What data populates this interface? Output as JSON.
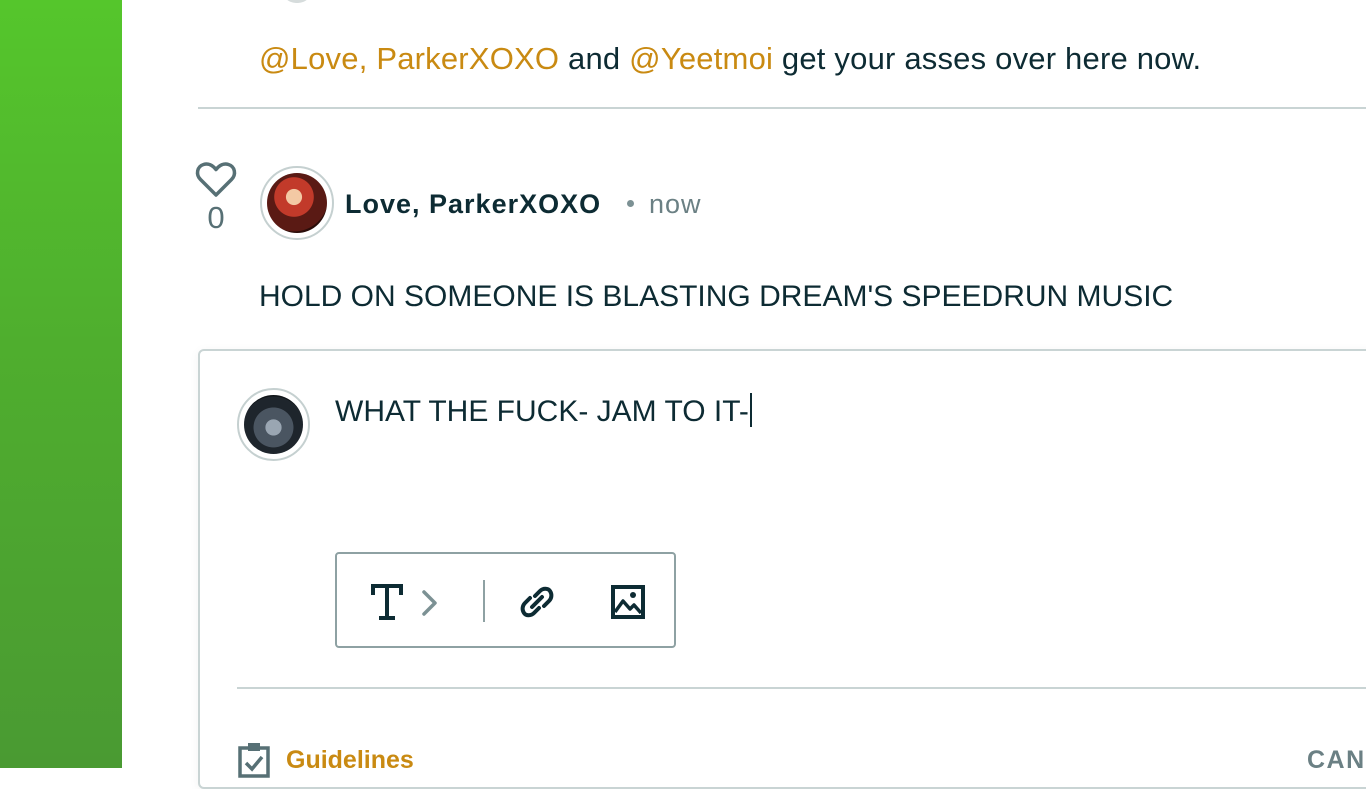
{
  "previous_comment": {
    "mention_1": "@Love, ParkerXOXO",
    "text_1": " and ",
    "mention_2": "@Yeetmoi",
    "text_2": " get your asses over here now."
  },
  "comment": {
    "like_count": "0",
    "author": "Love, ParkerXOXO",
    "timestamp": "now",
    "body": "HOLD ON SOMEONE IS BLASTING DREAM'S SPEEDRUN MUSIC"
  },
  "reply": {
    "value": "WHAT THE FUCK- JAM TO IT-"
  },
  "toolbar": {
    "icons": [
      "text-format-icon",
      "chevron-right-icon",
      "link-icon",
      "image-icon"
    ]
  },
  "footer": {
    "guidelines_label": "Guidelines",
    "cancel_label": "CANC"
  },
  "colors": {
    "accent": "#c98a12",
    "text": "#0d2b33",
    "muted": "#6b8084",
    "border": "#c9d4d4",
    "sidebar_green": "#4fae2e"
  }
}
